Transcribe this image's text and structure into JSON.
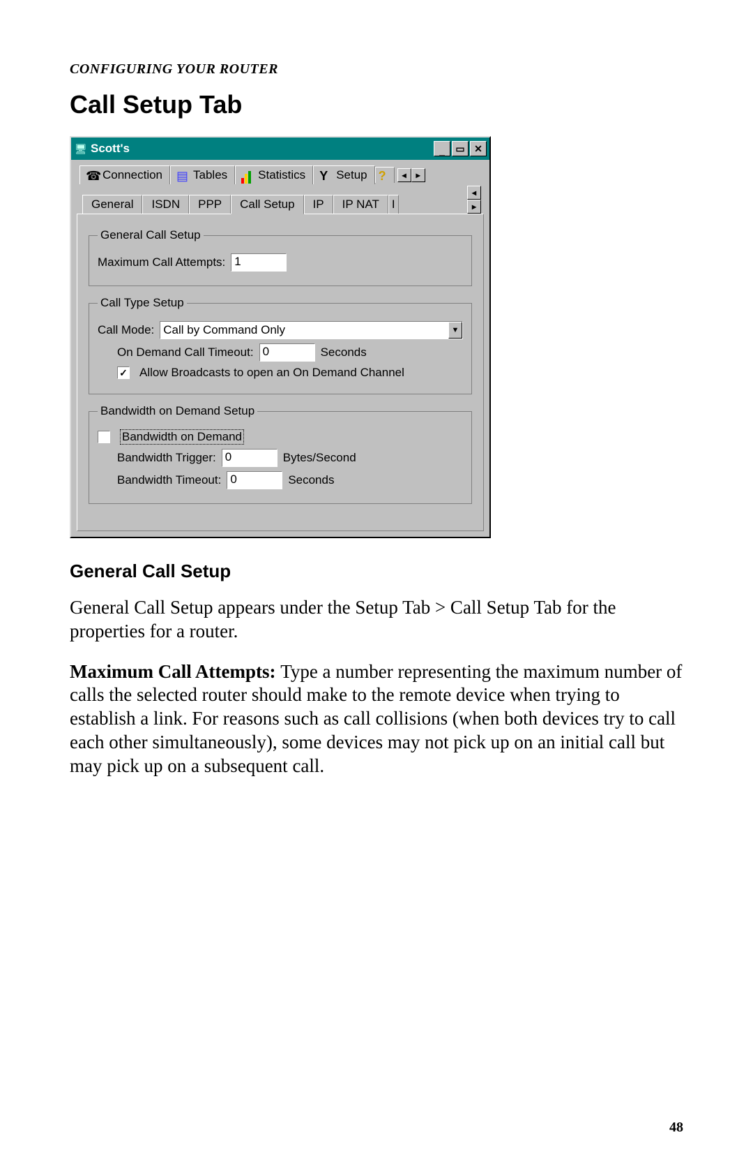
{
  "doc": {
    "breadcrumb": "CONFIGURING YOUR ROUTER",
    "section_title": "Call Setup Tab",
    "subheading": "General Call Setup",
    "paragraph1": "General Call Setup appears under the Setup Tab > Call Setup Tab for the properties for a router.",
    "para2_bold": "Maximum Call Attempts: ",
    "paragraph2_rest": "Type a number representing the maximum number of calls the selected router should make to the remote device when trying to establish a link.  For reasons such as call collisions (when both devices try to call each other simultaneously), some devices may not pick up on an initial call but may pick up on a subsequent call.",
    "page_number": "48"
  },
  "window": {
    "title": "Scott's",
    "main_tabs": {
      "connection": "Connection",
      "tables": "Tables",
      "statistics": "Statistics",
      "setup": "Setup"
    },
    "sub_tabs": {
      "general": "General",
      "isdn": "ISDN",
      "ppp": "PPP",
      "call_setup": "Call Setup",
      "ip": "IP",
      "ip_nat": "IP NAT",
      "extra": "I"
    },
    "group_general": {
      "legend": "General Call Setup",
      "max_attempts_label": "Maximum Call Attempts:",
      "max_attempts_value": "1"
    },
    "group_type": {
      "legend": "Call Type Setup",
      "call_mode_label": "Call Mode:",
      "call_mode_value": "Call by Command Only",
      "timeout_label": "On Demand Call Timeout:",
      "timeout_value": "0",
      "timeout_unit": "Seconds",
      "allow_broadcasts_checked": true,
      "allow_broadcasts_label": "Allow Broadcasts to open an On Demand Channel"
    },
    "group_bod": {
      "legend": "Bandwidth on Demand Setup",
      "bod_checked": false,
      "bod_label": "Bandwidth on Demand",
      "trigger_label": "Bandwidth Trigger:",
      "trigger_value": "0",
      "trigger_unit": "Bytes/Second",
      "timeout_label": "Bandwidth Timeout:",
      "timeout_value": "0",
      "timeout_unit": "Seconds"
    }
  }
}
